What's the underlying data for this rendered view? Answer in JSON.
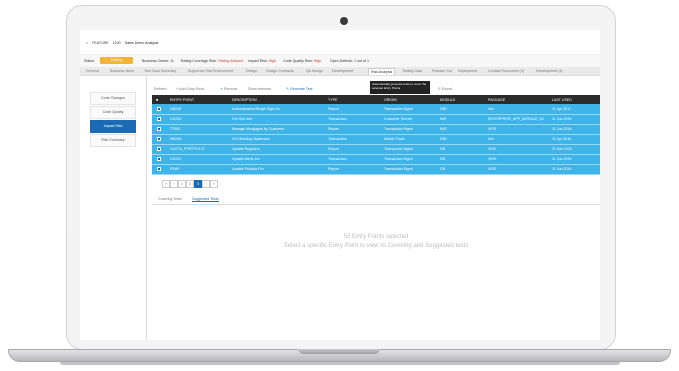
{
  "app": {
    "breadcrumb": [
      "FEATURE",
      "1240",
      "Sales Demo Analysis"
    ]
  },
  "status": {
    "label": "Status",
    "value": "Testing",
    "items": [
      {
        "label": "Business Owner:",
        "value": "JL"
      },
      {
        "label": "Testing Coverage Risk:",
        "value": "Testing Advised"
      },
      {
        "label": "Impact Risk:",
        "value": "High"
      },
      {
        "label": "Code Quality Risk:",
        "value": "High"
      },
      {
        "label": "Open Defects:",
        "value": "1 out of 1"
      }
    ]
  },
  "tabs": [
    "General",
    "Business Need",
    "Test Case Summary",
    "Supported Test Environment",
    "Design",
    "Design Contracts",
    "Qa Design",
    "Development",
    "Risk Analysis",
    "Testing Data",
    "Release Cal.",
    "Deployment",
    "Contact Resources (4)",
    "Development (4)"
  ],
  "active_tab": "Risk Analysis",
  "sidebar": {
    "items": [
      "Code Changes",
      "Code Quality",
      "Impact Risk",
      "Risk Summary"
    ],
    "active": "Impact Risk"
  },
  "toolbar": {
    "refresh": "Refresh",
    "add": "Add Entry Point",
    "remove": "Remove",
    "show_relevant": "Show relevant",
    "generate": "Generate Test",
    "export": "Export",
    "tooltip": "Automatically generate tests to cover the selected Entry Points"
  },
  "table": {
    "columns": [
      "ENTRY POINT",
      "DESCRIPTION",
      "TYPE",
      "ORIGIN",
      "MODULE",
      "PACKAGE",
      "LAST USED"
    ],
    "rows": [
      [
        "DB245",
        "Authentication/Single Sign-On",
        "Report",
        "Transaction Mgmt",
        "DB2",
        "Net",
        "11 Apr 2017"
      ],
      [
        "CUS01",
        "Get Sub Info",
        "Transaction",
        "Customer Service",
        "IMS",
        "ENTERPRISE_APP_MODULE_03",
        "11 Jun 2016"
      ],
      [
        "T7903",
        "Manage Mortgages by Customer",
        "Report",
        "Transaction Mgmt",
        "IMS",
        "VIDE",
        "11 Jun 2016"
      ],
      [
        "WB403",
        "Get Wording Statement",
        "Transaction",
        "Mobile Trade",
        "DB2",
        "Net",
        "11 Apr 2016"
      ],
      [
        "CUSTA_PORTFOLIO",
        "Update Registers",
        "Report",
        "Transaction Mgmt",
        "DB",
        "VIDE",
        "11 Mar 2016"
      ],
      [
        "CUS11",
        "Update Alerts Inc",
        "Transaction",
        "Transaction Mgmt",
        "DB",
        "VIDE",
        "11 Jun 2016"
      ],
      [
        "PSAP",
        "Update Prodata Pro",
        "Report",
        "Transaction Mgmt",
        "DB",
        "VIDE",
        "11 Jun 2016"
      ]
    ]
  },
  "pager": {
    "buttons": [
      "«",
      "‹",
      "1",
      "2",
      "3",
      "›",
      "»"
    ],
    "active": "3"
  },
  "subtabs": [
    "Covering Tests",
    "Suggested Tests"
  ],
  "active_subtab": "Suggested Tests",
  "empty_state": {
    "line1": "50 Entry Points selected",
    "line2": "Select a specific Entry Point to view its Covering and Suggested tests"
  },
  "colors": {
    "accent": "#1a6bb4",
    "table_highlight": "#3fb4e8",
    "status_pill": "#f3b43a",
    "risk_text": "#d03b2f"
  },
  "icons": {
    "back": "home-icon",
    "add": "plus-icon",
    "remove": "x-icon",
    "generate": "pencil-icon",
    "export": "export-icon"
  }
}
